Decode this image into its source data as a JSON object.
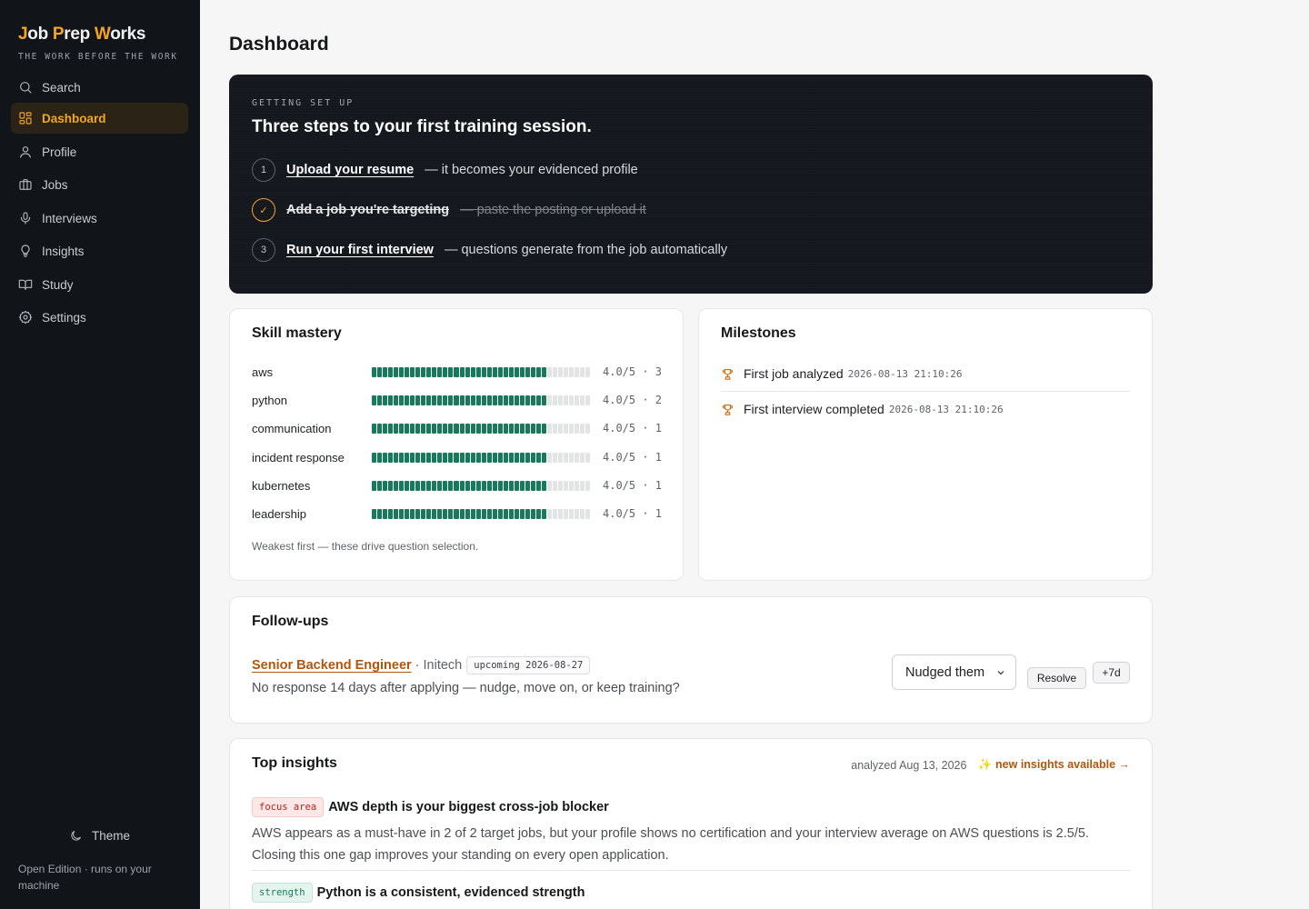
{
  "brand": {
    "part1_accent": "J",
    "part1_rest": "ob ",
    "part2_accent": "P",
    "part2_rest": "rep ",
    "part3_accent": "W",
    "part3_rest": "orks",
    "tagline": "THE WORK BEFORE THE WORK"
  },
  "sidebar": {
    "items": [
      {
        "label": "Search",
        "icon": "search-icon"
      },
      {
        "label": "Dashboard",
        "icon": "dashboard-icon",
        "active": true
      },
      {
        "label": "Profile",
        "icon": "user-icon"
      },
      {
        "label": "Jobs",
        "icon": "briefcase-icon"
      },
      {
        "label": "Interviews",
        "icon": "microphone-icon"
      },
      {
        "label": "Insights",
        "icon": "lightbulb-icon"
      },
      {
        "label": "Study",
        "icon": "book-icon"
      },
      {
        "label": "Settings",
        "icon": "gear-icon"
      }
    ],
    "theme_label": "Theme",
    "edition_text": "Open Edition · runs on your machine"
  },
  "colors": {
    "accent": "#f5a524",
    "link": "#b1560d",
    "mastery_bar": "#167a5b",
    "sidebar_bg": "#111419"
  },
  "page": {
    "title": "Dashboard"
  },
  "setup": {
    "eyebrow": "GETTING SET UP",
    "title": "Three steps to your first training session.",
    "steps": [
      {
        "num": "1",
        "link": "Upload your resume",
        "desc": "— it becomes your evidenced profile",
        "done": false
      },
      {
        "num": "✓",
        "link": "Add a job you're targeting",
        "desc": "— paste the posting or upload it",
        "done": true
      },
      {
        "num": "3",
        "link": "Run your first interview",
        "desc": "— questions generate from the job automatically",
        "done": false
      }
    ]
  },
  "skill_mastery": {
    "title": "Skill mastery",
    "skills": [
      {
        "name": "aws",
        "score": 4.0,
        "max": 5,
        "display": "4.0/5 · 3"
      },
      {
        "name": "python",
        "score": 4.0,
        "max": 5,
        "display": "4.0/5 · 2"
      },
      {
        "name": "communication",
        "score": 4.0,
        "max": 5,
        "display": "4.0/5 · 1"
      },
      {
        "name": "incident response",
        "score": 4.0,
        "max": 5,
        "display": "4.0/5 · 1"
      },
      {
        "name": "kubernetes",
        "score": 4.0,
        "max": 5,
        "display": "4.0/5 · 1"
      },
      {
        "name": "leadership",
        "score": 4.0,
        "max": 5,
        "display": "4.0/5 · 1"
      }
    ],
    "note": "Weakest first — these drive question selection."
  },
  "milestones": {
    "title": "Milestones",
    "items": [
      {
        "label": "First job analyzed",
        "date": "2026-08-13 21:10:26",
        "icon": "trophy-icon"
      },
      {
        "label": "First interview completed",
        "date": "2026-08-13 21:10:26",
        "icon": "trophy-icon"
      }
    ]
  },
  "followups": {
    "title": "Follow-ups",
    "job_title": "Senior Backend Engineer",
    "company": "· Initech",
    "badge": "upcoming 2026-08-27",
    "description": "No response 14 days after applying — nudge, move on, or keep training?",
    "select_value": "Nudged them",
    "resolve_label": "Resolve",
    "snooze_label": "+7d"
  },
  "insights": {
    "title": "Top insights",
    "analyzed": "analyzed Aug 13, 2026",
    "new_label": "new insights available →",
    "items": [
      {
        "tag": "focus area",
        "headline": "AWS depth is your biggest cross-job blocker",
        "body": "AWS appears as a must-have in 2 of 2 target jobs, but your profile shows no certification and your interview average on AWS questions is 2.5/5. Closing this one gap improves your standing on every open application."
      },
      {
        "tag": "strength",
        "headline": "Python is a consistent, evidenced strength",
        "body": ""
      }
    ]
  }
}
